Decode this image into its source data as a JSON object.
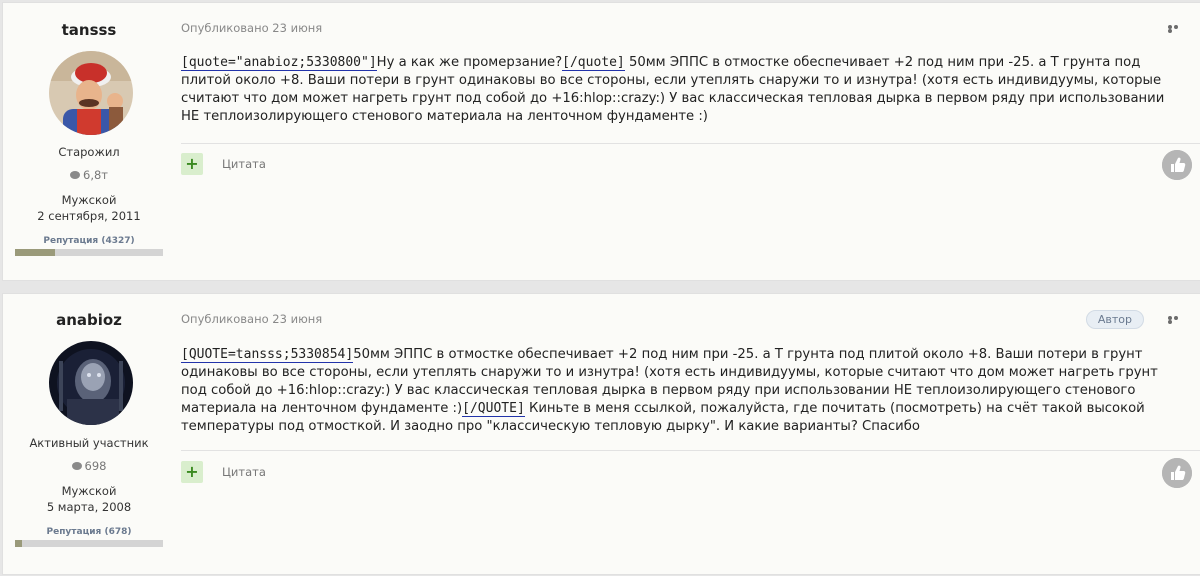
{
  "posts": [
    {
      "author": {
        "name": "tansss",
        "rank": "Старожил",
        "post_count": "6,8т",
        "gender": "Мужской",
        "joined": "2 сентября, 2011",
        "reputation_label": "Репутация (4327)",
        "reputation_fraction": 0.27
      },
      "published": "Опубликовано 23 июня",
      "body": {
        "quote_open": "[quote=\"anabioz;5330800\"]",
        "quoted_text": "Ну а как же промерзание?",
        "quote_close": "[/quote]",
        "rest": " 50мм ЭППС в отмостке обеспечивает +2 под ним при -25. а Т грунта под плитой около +8. Ваши потери в грунт одинаковы во все стороны, если утеплять снаружи то и изнутра! (хотя есть индивидуумы, которые считают что дом может нагреть грунт под собой до +16:hlop::crazy:) У вас классическая тепловая дырка в первом ряду при использовании НЕ теплоизолирующего стенового материала на ленточном фундаменте :)"
      },
      "quote_label": "Цитата",
      "plus_label": "+"
    },
    {
      "author": {
        "name": "anabioz",
        "rank": "Активный участник",
        "post_count": "698",
        "gender": "Мужской",
        "joined": "5 марта, 2008",
        "reputation_label": "Репутация (678)",
        "reputation_fraction": 0.05
      },
      "published": "Опубликовано 23 июня",
      "author_badge": "Автор",
      "body": {
        "quote_open": "[QUOTE=tansss;5330854]",
        "quoted_text": "50мм ЭППС в отмостке обеспечивает +2 под ним при -25. а Т грунта под плитой около +8. Ваши потери в грунт одинаковы во все стороны, если утеплять снаружи то и изнутра! (хотя есть индивидуумы, которые считают что дом может нагреть грунт под собой до +16:hlop::crazy:) У вас классическая тепловая дырка в первом ряду при использовании НЕ теплоизолирующего стенового материала на ленточном фундаменте :)",
        "quote_close": "[/QUOTE]",
        "rest": " Киньте в меня ссылкой, пожалуйста, где почитать (посмотреть) на счёт такой высокой температуры под отмосткой. И заодно про \"классическую тепловую дырку\". И какие варианты? Спасибо"
      },
      "quote_label": "Цитата",
      "plus_label": "+"
    }
  ],
  "colors": {
    "post_bg": "#fbfbf8",
    "page_bg": "#e6e6e6",
    "plus_bg": "#d9eecd",
    "plus_fg": "#3a8a20",
    "underline": "#2233aa"
  },
  "icons": {
    "more": "more-horizontal-icon",
    "like": "thumbs-up-icon",
    "post_count": "speech-bubble-icon"
  }
}
